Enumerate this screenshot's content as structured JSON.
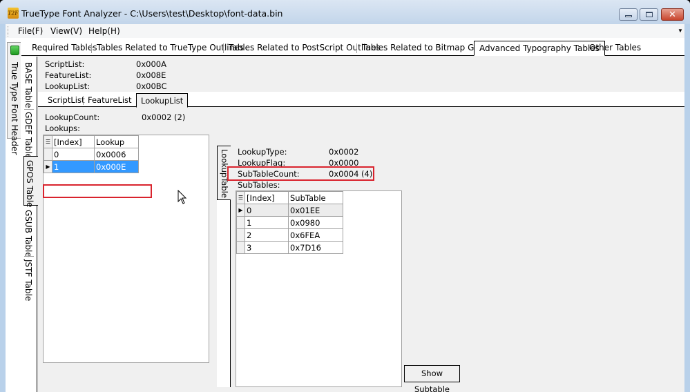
{
  "window": {
    "title": "TrueType Font Analyzer - C:\\Users\\test\\Desktop\\font-data.bin",
    "app_icon_text": "T2F",
    "controls": {
      "minimize": "minimize",
      "maximize": "maximize",
      "close": "✕"
    }
  },
  "menu": {
    "items": [
      {
        "label": "File(F)"
      },
      {
        "label": "View(V)"
      },
      {
        "label": "Help(H)"
      }
    ],
    "overflow_glyph": "▼"
  },
  "left_tabs": [
    {
      "label": "True Type Font Header",
      "icon": "book-icon"
    }
  ],
  "outer_tabs": [
    {
      "label": "Required Tables"
    },
    {
      "label": "Tables Related to TrueType Outlines"
    },
    {
      "label": "Tables Related to PostScript Outlines"
    },
    {
      "label": "Tables Related to Bitmap Glyphs"
    },
    {
      "label": "Advanced Typography Tables",
      "active": true
    },
    {
      "label": "Other Tables"
    }
  ],
  "inner_tabs": [
    {
      "label": "BASE Table"
    },
    {
      "label": "GDEF Table"
    },
    {
      "label": "GPOS Table",
      "active": true
    },
    {
      "label": "GSUB Table"
    },
    {
      "label": "JSTF Table"
    }
  ],
  "gpos": {
    "fields": [
      {
        "label": "ScriptList:",
        "value": "0x000A"
      },
      {
        "label": "FeatureList:",
        "value": "0x008E"
      },
      {
        "label": "LookupList:",
        "value": "0x00BC"
      }
    ],
    "sub_tabs": [
      {
        "label": "ScriptList"
      },
      {
        "label": "FeatureList"
      },
      {
        "label": "LookupList",
        "active": true
      }
    ],
    "lookup_list": {
      "count_label": "LookupCount:",
      "count_value": "0x0002 (2)",
      "lookups_label": "Lookups:",
      "columns": [
        "[Index]",
        "Lookup"
      ],
      "rows": [
        {
          "index": "0",
          "lookup": "0x0006"
        },
        {
          "index": "1",
          "lookup": "0x000E",
          "selected": true
        }
      ]
    },
    "lookup_table": {
      "tab_label": "LookupTable",
      "fields": [
        {
          "label": "LookupType:",
          "value": "0x0002"
        },
        {
          "label": "LookupFlag:",
          "value": "0x0000"
        },
        {
          "label": "SubTableCount:",
          "value": "0x0004 (4)"
        }
      ],
      "subtables_label": "SubTables:",
      "columns": [
        "[Index]",
        "SubTable"
      ],
      "rows": [
        {
          "index": "0",
          "subtable": "0x01EE",
          "current": true
        },
        {
          "index": "1",
          "subtable": "0x0980"
        },
        {
          "index": "2",
          "subtable": "0x6FEA"
        },
        {
          "index": "3",
          "subtable": "0x7D16"
        }
      ],
      "show_button": "Show Subtable"
    }
  },
  "colors": {
    "highlight_box": "#d9232d",
    "selection": "#3399ff"
  }
}
